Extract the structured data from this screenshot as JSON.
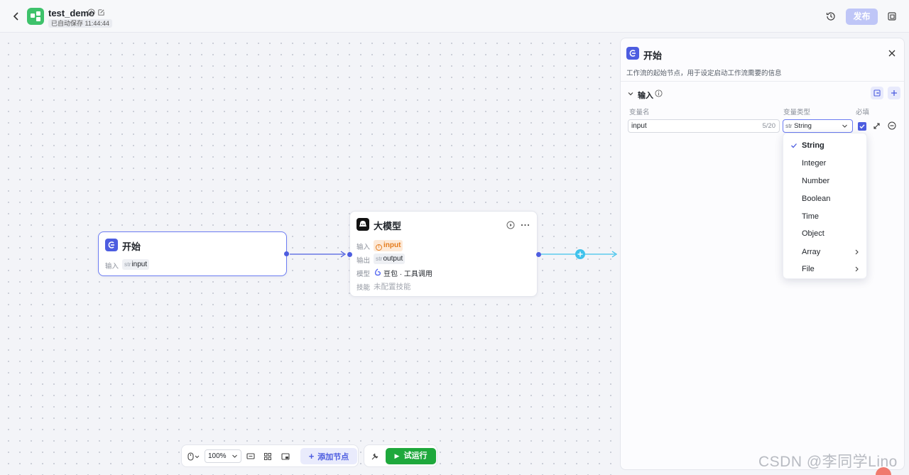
{
  "header": {
    "app_name": "test_demo",
    "autosave": "已自动保存 11:44:44",
    "publish_label": "发布"
  },
  "colors": {
    "accent": "#4d5de0",
    "run_green": "#1ea83c",
    "start_border": "#6c7cf2",
    "edge_cyan": "#3fc2ec"
  },
  "canvas": {
    "start_node": {
      "title": "开始",
      "input_label": "输入",
      "input_var": {
        "prefix": "str",
        "name": "input"
      }
    },
    "llm_node": {
      "title": "大模型",
      "rows": [
        {
          "label": "输入",
          "value": "input",
          "icon": "warning-circle-icon"
        },
        {
          "label": "输出",
          "prefix": "str",
          "value": "output"
        },
        {
          "label": "模型",
          "value": "豆包 · 工具调用",
          "icon": "doubao-model-icon"
        },
        {
          "label": "技能",
          "value": "未配置技能"
        }
      ]
    },
    "toolbar": {
      "zoom": "100%",
      "add_node_label": "添加节点",
      "run_label": "试运行"
    }
  },
  "panel": {
    "title": "开始",
    "description": "工作流的起始节点，用于设定启动工作流需要的信息",
    "section_title": "输入",
    "columns": {
      "name": "变量名",
      "type": "变量类型",
      "required": "必填"
    },
    "variable": {
      "name": "input",
      "count": "5/20",
      "type_prefix": "str",
      "type": "String",
      "required": true
    },
    "type_options": [
      {
        "label": "String",
        "selected": true,
        "submenu": false
      },
      {
        "label": "Integer",
        "selected": false,
        "submenu": false
      },
      {
        "label": "Number",
        "selected": false,
        "submenu": false
      },
      {
        "label": "Boolean",
        "selected": false,
        "submenu": false
      },
      {
        "label": "Time",
        "selected": false,
        "submenu": false
      },
      {
        "label": "Object",
        "selected": false,
        "submenu": false
      },
      {
        "label": "Array",
        "selected": false,
        "submenu": true
      },
      {
        "label": "File",
        "selected": false,
        "submenu": true
      }
    ]
  },
  "watermark": "CSDN @李同学Lino"
}
